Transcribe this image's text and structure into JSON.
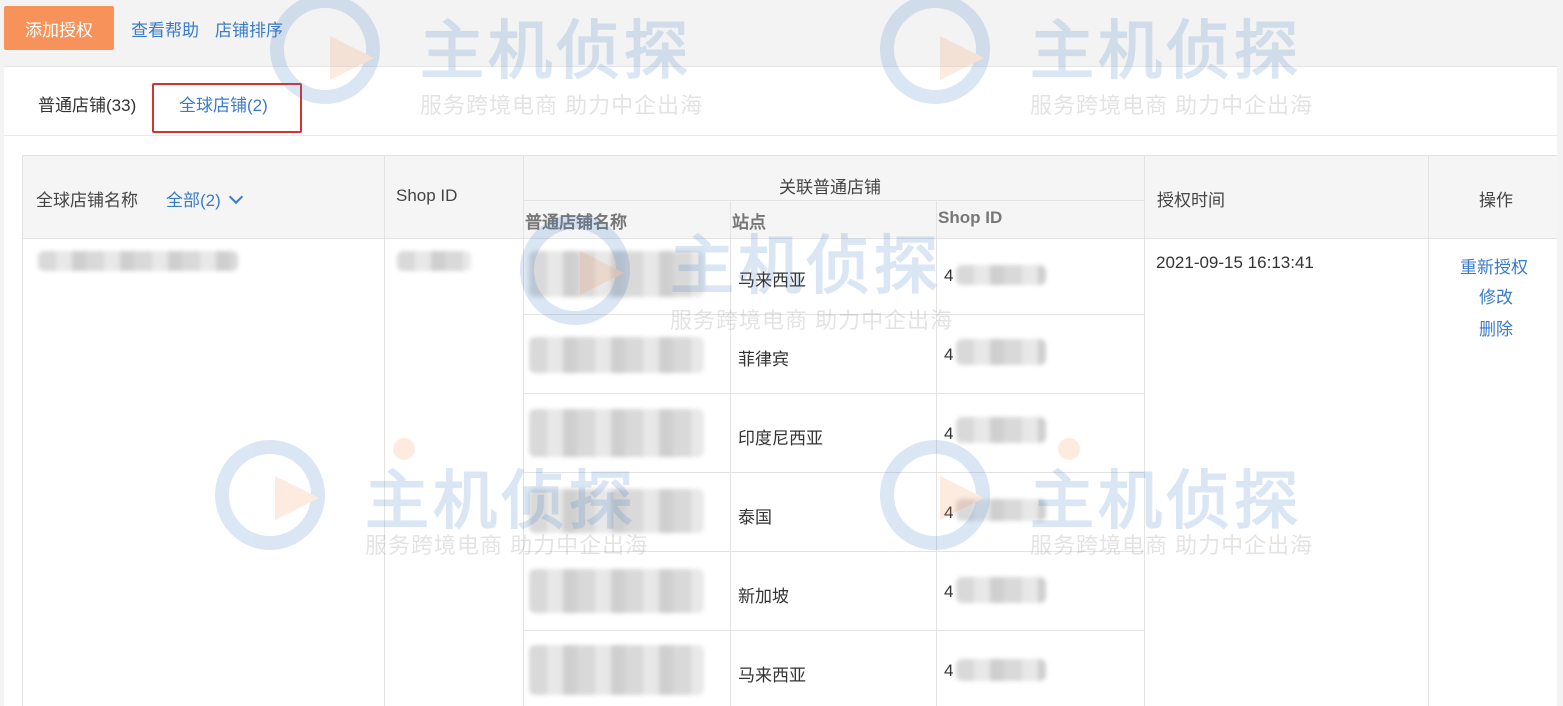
{
  "toolbar": {
    "add_auth": "添加授权",
    "help": "查看帮助",
    "sort": "店铺排序"
  },
  "tabs": [
    {
      "label": "普通店铺(33)"
    },
    {
      "label": "全球店铺(2)"
    }
  ],
  "table": {
    "headers": {
      "global_name": "全球店铺名称",
      "filter_all": "全部(2)",
      "shop_id": "Shop ID",
      "linked": "关联普通店铺",
      "sub_name": "普通店铺名称",
      "sub_site": "站点",
      "sub_shop_id": "Shop ID",
      "auth_time": "授权时间",
      "ops": "操作"
    },
    "row": {
      "auth_time": "2021-09-15 16:13:41",
      "actions": [
        "重新授权",
        "修改",
        "删除"
      ],
      "sub_rows": [
        {
          "site": "马来西亚",
          "id_prefix": "4"
        },
        {
          "site": "菲律宾",
          "id_prefix": "4"
        },
        {
          "site": "印度尼西亚",
          "id_prefix": "4"
        },
        {
          "site": "泰国",
          "id_prefix": "4"
        },
        {
          "site": "新加坡",
          "id_prefix": "4"
        },
        {
          "site": "马来西亚",
          "id_prefix": "4"
        }
      ]
    }
  },
  "watermark": {
    "title": "主机侦探",
    "subtitle": "服务跨境电商 助力中企出海"
  },
  "colors": {
    "accent": "#3a7bc8",
    "primary_button": "#f7935a",
    "tab_highlight_border": "#d4332f"
  }
}
